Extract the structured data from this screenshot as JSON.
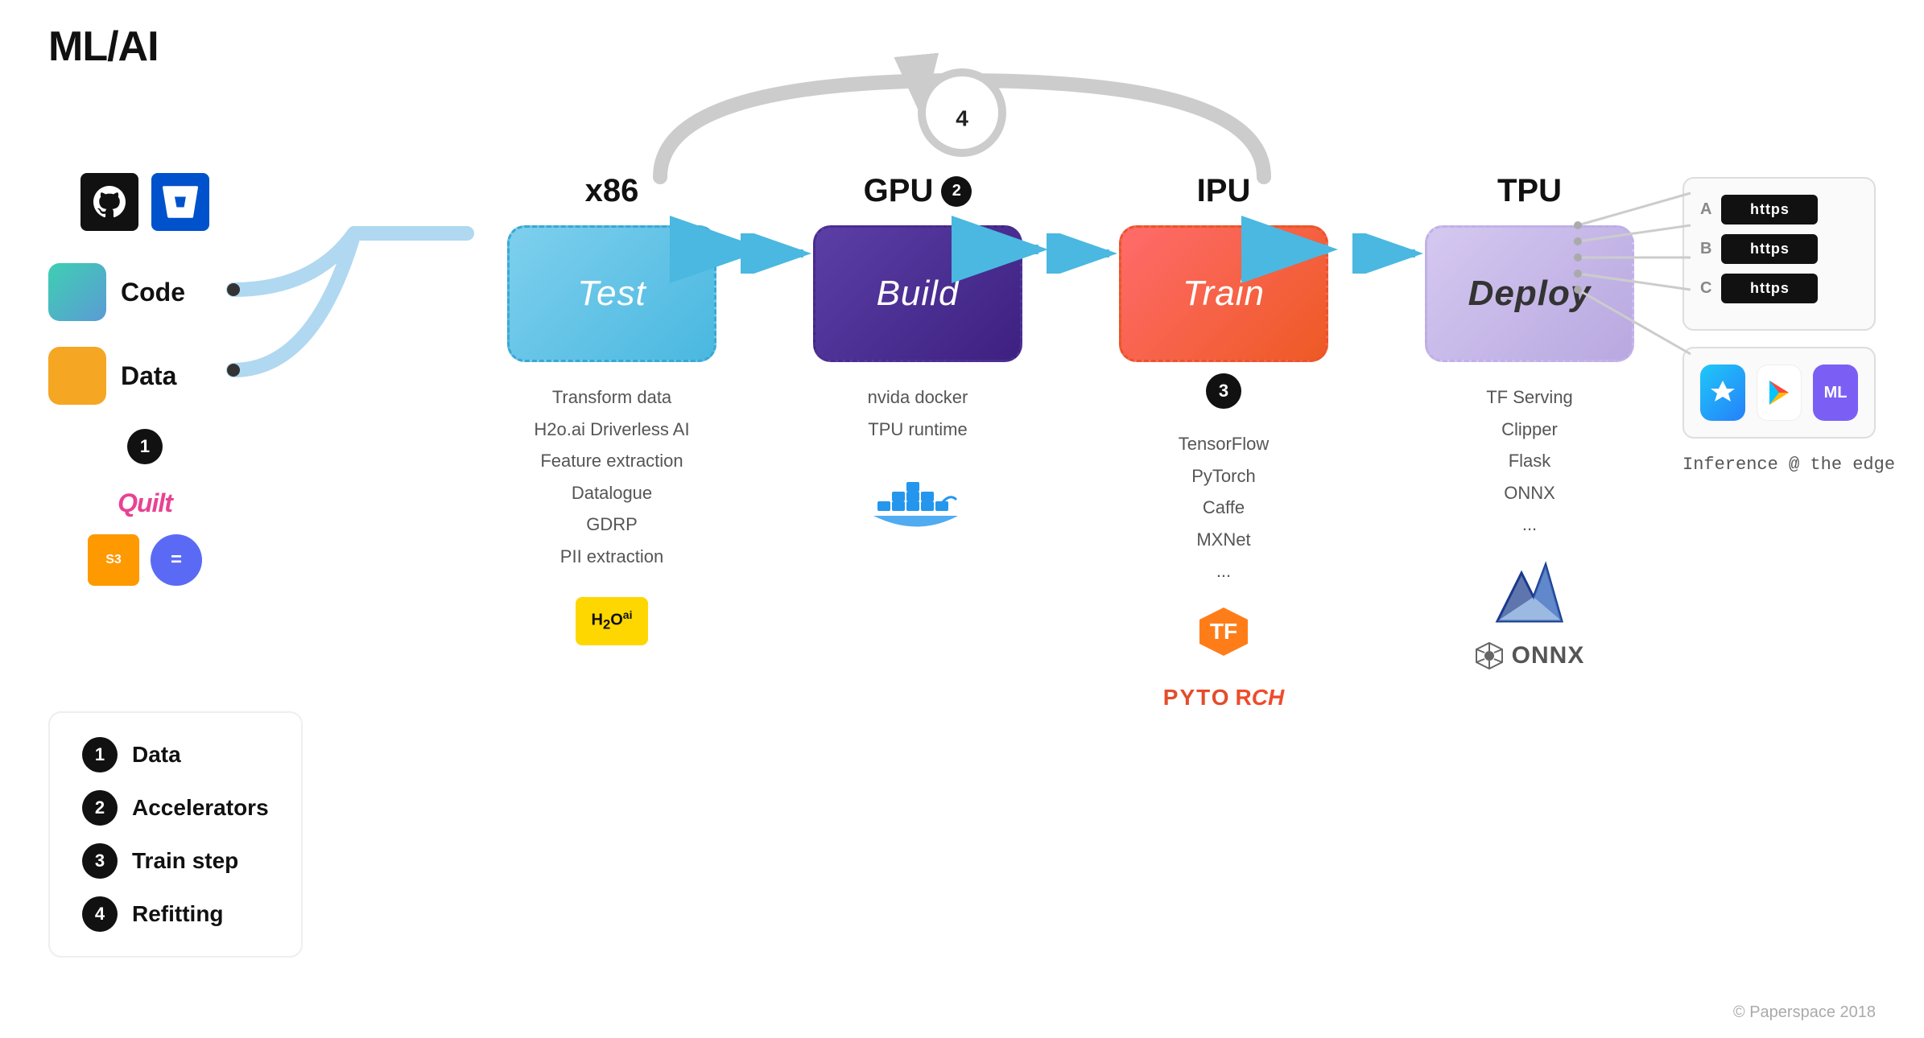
{
  "title": "ML/AI",
  "stages": [
    {
      "id": "test",
      "label": "x86",
      "badge": null,
      "box_text": "Test",
      "box_class": "test",
      "desc": [
        "Transform data",
        "H2o.ai Driverless AI",
        "Feature extraction",
        "Datalogue",
        "GDRP",
        "PII extraction"
      ],
      "logo": "h2o"
    },
    {
      "id": "build",
      "label": "GPU",
      "badge": "2",
      "box_text": "Build",
      "box_class": "build",
      "desc": [
        "nvida docker",
        "TPU runtime"
      ],
      "logo": "docker"
    },
    {
      "id": "train",
      "label": "IPU",
      "badge": "3",
      "box_text": "Train",
      "box_class": "train",
      "desc": [
        "TensorFlow",
        "PyTorch",
        "Caffe",
        "MXNet",
        "..."
      ],
      "logo": "tensorflow+pytorch"
    },
    {
      "id": "deploy",
      "label": "TPU",
      "badge": null,
      "box_text": "Deploy",
      "box_class": "deploy",
      "desc": [
        "TF Serving",
        "Clipper",
        "Flask",
        "ONNX",
        "..."
      ],
      "logo": "clipper+onnx"
    }
  ],
  "input": {
    "code_label": "Code",
    "data_label": "Data"
  },
  "output": {
    "endpoints": [
      {
        "letter": "A",
        "label": "https"
      },
      {
        "letter": "B",
        "label": "https"
      },
      {
        "letter": "C",
        "label": "https"
      }
    ],
    "inference_text": "Inference @ the edge"
  },
  "legend": [
    {
      "number": "1",
      "label": "Data"
    },
    {
      "number": "2",
      "label": "Accelerators"
    },
    {
      "number": "3",
      "label": "Train step"
    },
    {
      "number": "4",
      "label": "Refitting"
    }
  ],
  "refitting_number": "4",
  "footer": "© Paperspace 2018"
}
